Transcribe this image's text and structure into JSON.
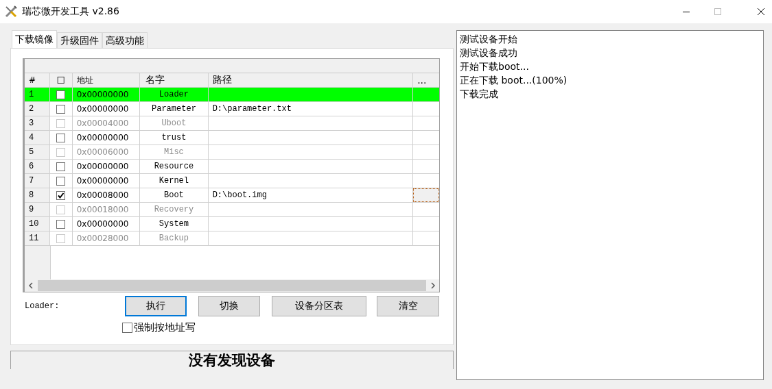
{
  "window": {
    "title": "瑞芯微开发工具 v2.86"
  },
  "tabs": [
    {
      "label": "下载镜像",
      "selected": true
    },
    {
      "label": "升级固件",
      "selected": false
    },
    {
      "label": "高级功能",
      "selected": false
    }
  ],
  "table": {
    "columns": [
      "#",
      "☐",
      "地址",
      "名字",
      "路径",
      "..."
    ],
    "rows": [
      {
        "number": "1",
        "checked": false,
        "address": "0x00000000",
        "name": "Loader",
        "path": "",
        "disabled": false,
        "selected": true,
        "focused": false
      },
      {
        "number": "2",
        "checked": false,
        "address": "0x00000000",
        "name": "Parameter",
        "path": "D:\\parameter.txt",
        "disabled": false,
        "selected": false,
        "focused": false
      },
      {
        "number": "3",
        "checked": false,
        "address": "0x00004000",
        "name": "Uboot",
        "path": "",
        "disabled": true,
        "selected": false,
        "focused": false
      },
      {
        "number": "4",
        "checked": false,
        "address": "0x00000000",
        "name": "trust",
        "path": "",
        "disabled": false,
        "selected": false,
        "focused": false
      },
      {
        "number": "5",
        "checked": false,
        "address": "0x00006000",
        "name": "Misc",
        "path": "",
        "disabled": true,
        "selected": false,
        "focused": false
      },
      {
        "number": "6",
        "checked": false,
        "address": "0x00000000",
        "name": "Resource",
        "path": "",
        "disabled": false,
        "selected": false,
        "focused": false
      },
      {
        "number": "7",
        "checked": false,
        "address": "0x00000000",
        "name": "Kernel",
        "path": "",
        "disabled": false,
        "selected": false,
        "focused": false
      },
      {
        "number": "8",
        "checked": true,
        "address": "0x00008000",
        "name": "Boot",
        "path": "D:\\boot.img",
        "disabled": false,
        "selected": false,
        "focused": true
      },
      {
        "number": "9",
        "checked": false,
        "address": "0x00018000",
        "name": "Recovery",
        "path": "",
        "disabled": true,
        "selected": false,
        "focused": false
      },
      {
        "number": "10",
        "checked": false,
        "address": "0x00000000",
        "name": "System",
        "path": "",
        "disabled": false,
        "selected": false,
        "focused": false
      },
      {
        "number": "11",
        "checked": false,
        "address": "0x00028000",
        "name": "Backup",
        "path": "",
        "disabled": true,
        "selected": false,
        "focused": false
      }
    ]
  },
  "loader_label": "Loader:",
  "buttons": [
    {
      "label": "执行",
      "focused": true
    },
    {
      "label": "切换",
      "focused": false
    },
    {
      "label": "设备分区表",
      "focused": false
    },
    {
      "label": "清空",
      "focused": false
    }
  ],
  "force_address_write": {
    "label": "强制按地址写",
    "checked": false
  },
  "status": "没有发现设备",
  "log": [
    "测试设备开始",
    "测试设备成功",
    "开始下载boot...",
    "正在下载 boot...(100%)",
    "下载完成"
  ]
}
